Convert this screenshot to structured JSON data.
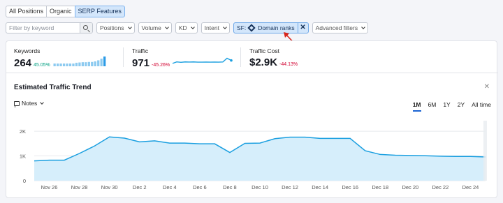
{
  "tabs": [
    {
      "label": "All Positions",
      "active": false
    },
    {
      "label": "Organic",
      "active": false
    },
    {
      "label": "SERP Features",
      "active": true
    }
  ],
  "filters": {
    "search_placeholder": "Filter by keyword",
    "dropdowns": [
      "Positions",
      "Volume",
      "KD",
      "Intent"
    ],
    "sf_prefix": "SF:",
    "sf_value": "Domain ranks",
    "advanced": "Advanced filters"
  },
  "metrics": [
    {
      "label": "Keywords",
      "value": "264",
      "change": "45.05%",
      "change_color": "#009f81"
    },
    {
      "label": "Traffic",
      "value": "971",
      "change": "-45.26%",
      "change_color": "#d1002f"
    },
    {
      "label": "Traffic Cost",
      "value": "$2.9K",
      "change": "-44.13%",
      "change_color": "#d1002f"
    }
  ],
  "trend": {
    "title": "Estimated Traffic Trend",
    "notes_label": "Notes",
    "ranges": [
      "1M",
      "6M",
      "1Y",
      "2Y",
      "All time"
    ],
    "active_range": "1M"
  },
  "colors": {
    "accent": "#1a9fe0",
    "fill": "#d6eefb"
  },
  "sparklines": {
    "keywords": [
      1,
      1,
      1,
      1,
      1,
      1,
      1,
      1.3,
      1.4,
      1.5,
      1.5,
      1.6,
      1.6,
      1.8,
      2.2,
      2.8,
      3.6
    ],
    "traffic": [
      0.3,
      0.5,
      0.45,
      0.5,
      0.48,
      0.5,
      0.47,
      0.47,
      0.48,
      0.47,
      0.48,
      0.47,
      0.5,
      1.0,
      0.7
    ]
  },
  "chart_data": {
    "type": "area",
    "x": [
      "Nov 25",
      "Nov 26",
      "Nov 27",
      "Nov 28",
      "Nov 29",
      "Nov 30",
      "Dec 1",
      "Dec 2",
      "Dec 3",
      "Dec 4",
      "Dec 5",
      "Dec 6",
      "Dec 7",
      "Dec 8",
      "Dec 9",
      "Dec 10",
      "Dec 11",
      "Dec 12",
      "Dec 13",
      "Dec 14",
      "Dec 15",
      "Dec 16",
      "Dec 17",
      "Dec 18",
      "Dec 19",
      "Dec 20",
      "Dec 21",
      "Dec 22",
      "Dec 23",
      "Dec 24",
      "Dec 25"
    ],
    "series": [
      {
        "values": [
          800,
          830,
          830,
          1100,
          1400,
          1770,
          1720,
          1570,
          1610,
          1520,
          1520,
          1490,
          1490,
          1140,
          1510,
          1520,
          1700,
          1760,
          1760,
          1710,
          1710,
          1710,
          1210,
          1060,
          1030,
          1020,
          1010,
          990,
          980,
          980,
          960
        ]
      }
    ],
    "xticks": [
      "Nov 26",
      "Nov 28",
      "Nov 30",
      "Dec 2",
      "Dec 4",
      "Dec 6",
      "Dec 8",
      "Dec 10",
      "Dec 12",
      "Dec 14",
      "Dec 16",
      "Dec 18",
      "Dec 20",
      "Dec 22",
      "Dec 24"
    ],
    "yticks": [
      "0",
      "1K",
      "2K"
    ],
    "ylim": [
      0,
      2200
    ],
    "title": "Estimated Traffic Trend",
    "xlabel": "",
    "ylabel": ""
  }
}
